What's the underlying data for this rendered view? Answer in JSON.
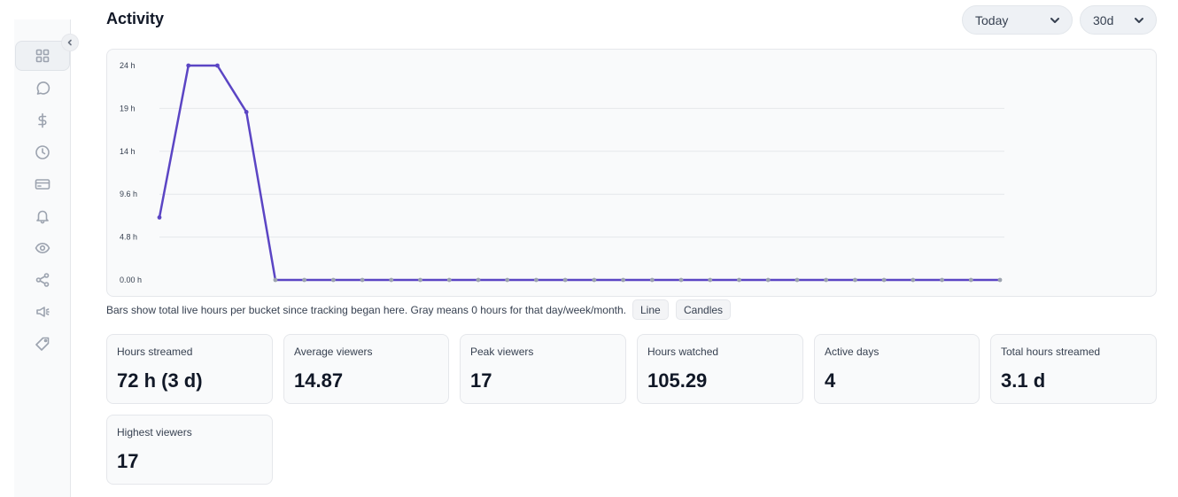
{
  "header": {
    "title": "Activity"
  },
  "filters": {
    "range": "Today",
    "period": "30d"
  },
  "sidebar": {
    "items": [
      {
        "icon": "grid-icon",
        "active": true
      },
      {
        "icon": "chat-icon"
      },
      {
        "icon": "dollar-icon"
      },
      {
        "icon": "clock-icon"
      },
      {
        "icon": "card-icon"
      },
      {
        "icon": "bell-icon"
      },
      {
        "icon": "eye-icon"
      },
      {
        "icon": "share-icon"
      },
      {
        "icon": "megaphone-icon"
      },
      {
        "icon": "tag-icon"
      }
    ]
  },
  "chart_data": {
    "type": "line",
    "y_ticks": [
      "24 h",
      "19 h",
      "14 h",
      "9.6 h",
      "4.8 h",
      "0.00 h"
    ],
    "ylim": [
      0,
      24
    ],
    "x": [
      1,
      2,
      3,
      4,
      5,
      6,
      7,
      8,
      9,
      10,
      11,
      12,
      13,
      14,
      15,
      16,
      17,
      18,
      19,
      20,
      21,
      22,
      23,
      24,
      25,
      26,
      27,
      28,
      29,
      30
    ],
    "series": [
      {
        "values": [
          7,
          24,
          24,
          18.8,
          0,
          0,
          0,
          0,
          0,
          0,
          0,
          0,
          0,
          0,
          0,
          0,
          0,
          0,
          0,
          0,
          0,
          0,
          0,
          0,
          0,
          0,
          0,
          0,
          0,
          0
        ]
      }
    ],
    "line_color": "#5b45c4",
    "zero_point_color": "#9ca3af",
    "grid": true
  },
  "chart_note": "Bars show total live hours per bucket since tracking began here. Gray means 0 hours for that day/week/month.",
  "chart_modes": {
    "line": "Line",
    "candles": "Candles"
  },
  "stats": [
    {
      "label": "Hours streamed",
      "value": "72 h (3 d)"
    },
    {
      "label": "Average viewers",
      "value": "14.87"
    },
    {
      "label": "Peak viewers",
      "value": "17"
    },
    {
      "label": "Hours watched",
      "value": "105.29"
    },
    {
      "label": "Active days",
      "value": "4"
    },
    {
      "label": "Total hours streamed",
      "value": "3.1 d"
    },
    {
      "label": "Highest viewers",
      "value": "17"
    }
  ]
}
